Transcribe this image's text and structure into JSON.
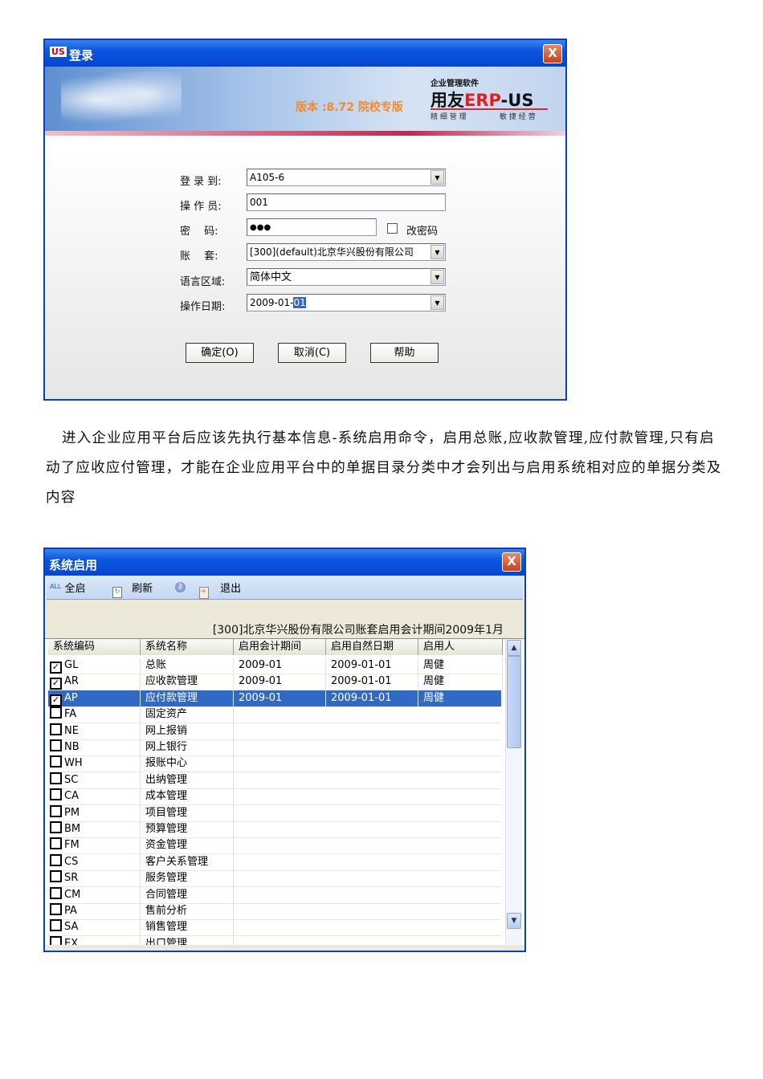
{
  "login": {
    "title": "登录",
    "close": "X",
    "logo_small": "US",
    "version": "版本 :8.72 院校专版",
    "brand_top": "企业管理软件",
    "brand_name": "用友",
    "brand_erp": "ERP",
    "brand_suffix": "-US",
    "slogan_left": "精 细 管 理",
    "slogan_right": "敏 捷 经 营",
    "fields": {
      "server_label": "登 录 到:",
      "server_value": "A105-6",
      "operator_label": "操 作 员:",
      "operator_value": "001",
      "password_label": "密　 码:",
      "password_value": "●●●",
      "change_pw_label": "改密码",
      "account_label": "账　 套:",
      "account_value": "[300](default)北京华兴股份有限公司",
      "locale_label": "语言区域:",
      "locale_value": "简体中文",
      "date_label": "操作日期:",
      "date_value_prefix": "2009-01-",
      "date_value_selected": "01"
    },
    "buttons": {
      "ok": "确定(O)",
      "cancel": "取消(C)",
      "help": "帮助"
    }
  },
  "paragraph": "进入企业应用平台后应该先执行基本信息-系统启用命令，启用总账,应收款管理,应付款管理,只有启动了应收应付管理，才能在企业应用平台中的单据目录分类中才会列出与启用系统相对应的单据分类及内容",
  "sysenable": {
    "title": "系统启用",
    "close": "X",
    "toolbar": {
      "all_icon": "ALL",
      "enable_all": "全启",
      "refresh": "刷新",
      "exit": "退出"
    },
    "subtitle": "[300]北京华兴股份有限公司账套启用会计期间2009年1月",
    "columns": [
      "系统编码",
      "系统名称",
      "启用会计期间",
      "启用自然日期",
      "启用人"
    ],
    "rows": [
      {
        "code": "GL",
        "name": "总账",
        "period": "2009-01",
        "date": "2009-01-01",
        "user": "周健",
        "checked": true
      },
      {
        "code": "AR",
        "name": "应收款管理",
        "period": "2009-01",
        "date": "2009-01-01",
        "user": "周健",
        "checked": true
      },
      {
        "code": "AP",
        "name": "应付款管理",
        "period": "2009-01",
        "date": "2009-01-01",
        "user": "周健",
        "checked": true,
        "selected": true
      },
      {
        "code": "FA",
        "name": "固定资产"
      },
      {
        "code": "NE",
        "name": "网上报销"
      },
      {
        "code": "NB",
        "name": "网上银行"
      },
      {
        "code": "WH",
        "name": "报账中心"
      },
      {
        "code": "SC",
        "name": "出纳管理"
      },
      {
        "code": "CA",
        "name": "成本管理"
      },
      {
        "code": "PM",
        "name": "项目管理"
      },
      {
        "code": "BM",
        "name": "预算管理"
      },
      {
        "code": "FM",
        "name": "资金管理"
      },
      {
        "code": "CS",
        "name": "客户关系管理"
      },
      {
        "code": "SR",
        "name": "服务管理"
      },
      {
        "code": "CM",
        "name": "合同管理"
      },
      {
        "code": "PA",
        "name": "售前分析"
      },
      {
        "code": "SA",
        "name": "销售管理"
      },
      {
        "code": "EX",
        "name": "出口管理"
      }
    ]
  }
}
